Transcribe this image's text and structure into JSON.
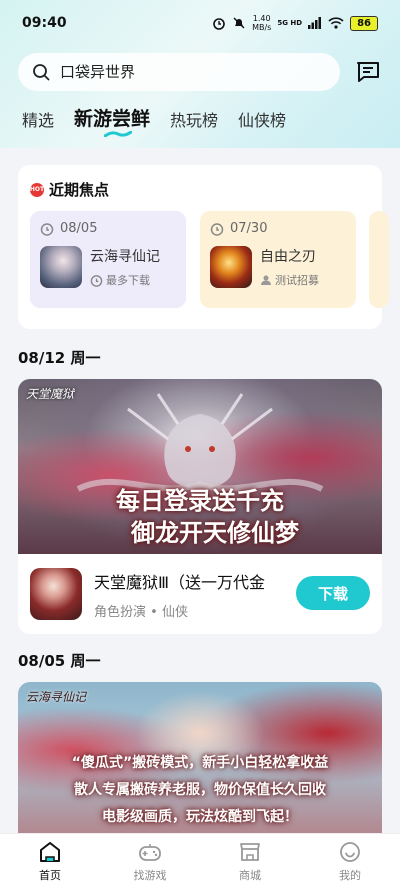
{
  "status_bar": {
    "time": "09:40",
    "net_speed": "1.40",
    "net_unit": "MB/s",
    "signal": "5G HD",
    "battery": "86"
  },
  "search": {
    "placeholder": "口袋异世界"
  },
  "tabs": [
    {
      "label": "精选",
      "active": false
    },
    {
      "label": "新游尝鲜",
      "active": true
    },
    {
      "label": "热玩榜",
      "active": false
    },
    {
      "label": "仙侠榜",
      "active": false
    }
  ],
  "focus": {
    "badge": "HOT",
    "title": "近期焦点",
    "events": [
      {
        "date": "08/05",
        "name": "云海寻仙记",
        "tag": "最多下载"
      },
      {
        "date": "07/30",
        "name": "自由之刃",
        "tag": "测试招募"
      }
    ]
  },
  "sections": [
    {
      "date": "08/12 周一",
      "banner_logo": "天堂魔狱",
      "banner_lines": [
        "每日登录送千充",
        "御龙开天修仙梦"
      ],
      "game_name": "天堂魔狱Ⅲ（送一万代金",
      "genre": "角色扮演",
      "subgenre": "仙侠",
      "download_label": "下载"
    },
    {
      "date": "08/05 周一",
      "banner_logo": "云海寻仙记",
      "banner_lines": [
        "“傻瓜式”搬砖模式，新手小白轻松拿收益",
        "散人专属搬砖养老服，物价保值长久回收",
        "电影级画质，玩法炫酷到飞起！"
      ]
    }
  ],
  "bottom_nav": [
    {
      "label": "首页",
      "icon": "home-icon",
      "active": true
    },
    {
      "label": "找游戏",
      "icon": "gamepad-icon",
      "active": false
    },
    {
      "label": "商城",
      "icon": "store-icon",
      "active": false
    },
    {
      "label": "我的",
      "icon": "smile-icon",
      "active": false
    }
  ],
  "colors": {
    "accent": "#20c8d0",
    "hot": "#e53935",
    "purple_card": "#eeebfb",
    "yellow_card": "#fdf1d8"
  }
}
